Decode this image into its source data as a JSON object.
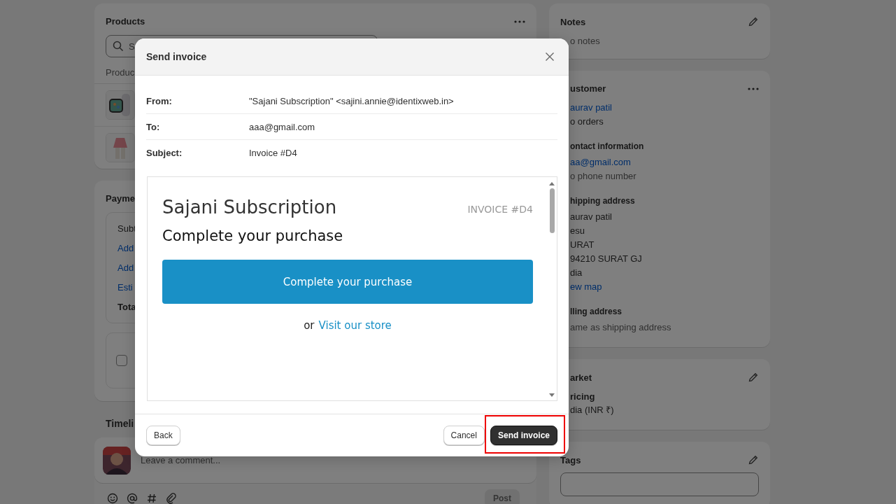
{
  "products": {
    "title": "Products",
    "search": {
      "placeholder": "S"
    },
    "column": "Produc"
  },
  "payment": {
    "title": "Payme",
    "lines": [
      {
        "text": "Subt",
        "kind": "plain"
      },
      {
        "text": "Add",
        "kind": "link"
      },
      {
        "text": "Add",
        "kind": "link"
      },
      {
        "text": "Esti",
        "kind": "link"
      },
      {
        "text": "Tota",
        "kind": "bold"
      }
    ],
    "checkbox": {
      "checked": false
    }
  },
  "timeline": {
    "title": "Timeli",
    "comment": {
      "placeholder": "Leave a comment..."
    },
    "post_button": "Post"
  },
  "notes": {
    "title": "Notes",
    "text": "o notes"
  },
  "customer": {
    "title": "ustomer",
    "sections": [
      {
        "lines": [
          {
            "text": "aurav patil",
            "kind": "link"
          },
          {
            "text": "o orders",
            "kind": "plain"
          }
        ]
      },
      {
        "title": "ontact information",
        "lines": [
          {
            "text": "aa@gmail.com",
            "kind": "link"
          },
          {
            "text": "o phone number",
            "kind": "muted"
          }
        ]
      },
      {
        "title": "hipping address",
        "lines": [
          {
            "text": "aurav patil",
            "kind": "plain"
          },
          {
            "text": "esu",
            "kind": "plain"
          },
          {
            "text": "URAT",
            "kind": "plain"
          },
          {
            "text": "94210 SURAT GJ",
            "kind": "plain"
          },
          {
            "text": "dia",
            "kind": "plain"
          },
          {
            "text": "ew map",
            "kind": "link"
          }
        ]
      },
      {
        "title": "lling address",
        "lines": [
          {
            "text": "ame as shipping address",
            "kind": "muted"
          }
        ]
      }
    ]
  },
  "market": {
    "title": "arket",
    "label": "ricing",
    "value": "dia (INR ₹)"
  },
  "tags": {
    "title": "Tags"
  },
  "dialog": {
    "title": "Send invoice",
    "fields": [
      {
        "label": "From:",
        "value": "\"Sajani Subscription\" <sajini.annie@identixweb.in>"
      },
      {
        "label": "To:",
        "value": "aaa@gmail.com"
      },
      {
        "label": "Subject:",
        "value": "Invoice #D4"
      }
    ],
    "preview": {
      "shop_name": "Sajani Subscription",
      "invoice_label": "INVOICE #D4",
      "heading": "Complete your purchase",
      "button": "Complete your purchase",
      "prefix": "or",
      "link": "Visit our store"
    },
    "back_button": "Back",
    "cancel_button": "Cancel",
    "send_button": {
      "label": "Send invoice",
      "highlighted": true
    }
  }
}
